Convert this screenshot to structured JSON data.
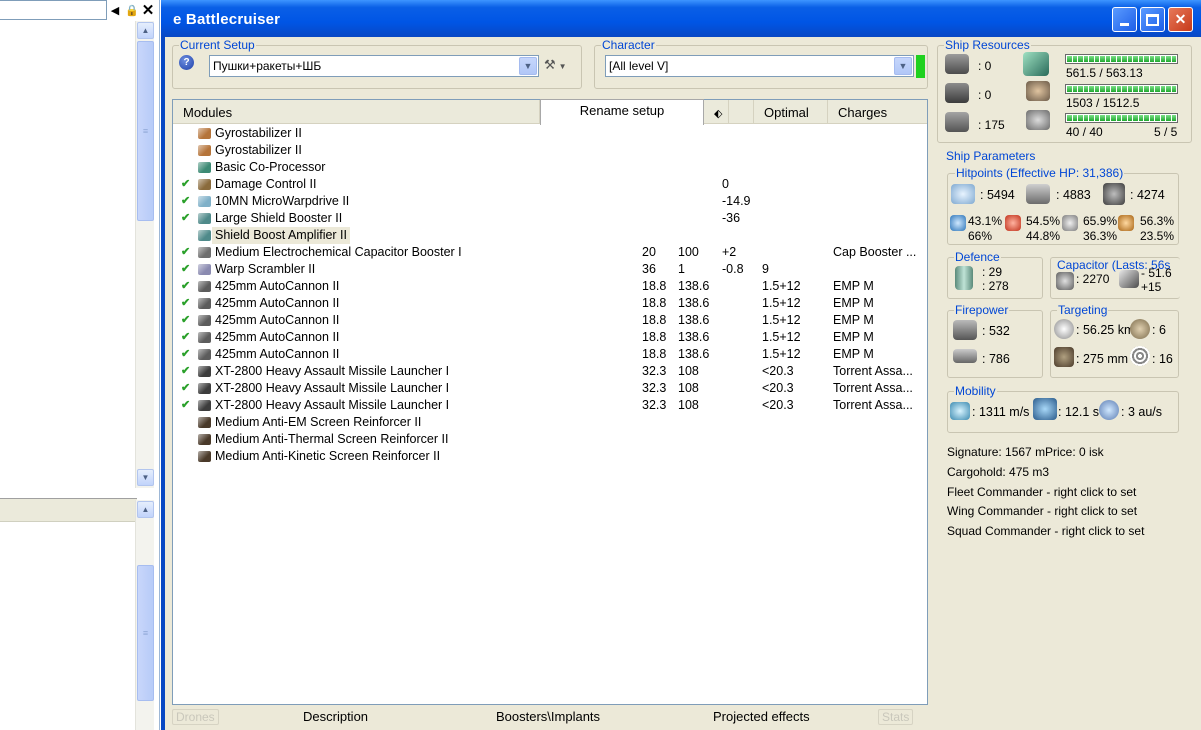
{
  "window": {
    "title": "e Battlecruiser"
  },
  "left_pane": {
    "topbar_icons": [
      "left-arrow-icon",
      "lock-icon",
      "close-icon"
    ]
  },
  "setup": {
    "group_label": "Current Setup",
    "value": "Пушки+ракеты+ШБ",
    "help_icon": "help-icon",
    "tool_icon": "wrench-icon"
  },
  "character": {
    "group_label": "Character",
    "value": "[All level V]",
    "indicator_color": "#1fd11f"
  },
  "modules": {
    "columns": [
      "Modules",
      "Rename setup",
      "",
      "Optimal",
      "Charges"
    ],
    "rows": [
      {
        "fit": false,
        "icon": "#b5743a",
        "name": "Gyrostabilizer II",
        "c1": "",
        "c2": "",
        "c3": "",
        "c4": "",
        "c5": ""
      },
      {
        "fit": false,
        "icon": "#b5743a",
        "name": "Gyrostabilizer II",
        "c1": "",
        "c2": "",
        "c3": "",
        "c4": "",
        "c5": ""
      },
      {
        "fit": false,
        "icon": "#3c8a74",
        "name": "Basic Co-Processor",
        "c1": "",
        "c2": "",
        "c3": "",
        "c4": "",
        "c5": ""
      },
      {
        "fit": true,
        "icon": "#8a6b3c",
        "name": "Damage Control II",
        "c1": "",
        "c2": "",
        "c3": "0",
        "c4": "",
        "c5": ""
      },
      {
        "fit": true,
        "icon": "#7fb0c8",
        "name": "10MN MicroWarpdrive II",
        "c1": "",
        "c2": "",
        "c3": "-14.9",
        "c4": "",
        "c5": ""
      },
      {
        "fit": true,
        "icon": "#4f8a8a",
        "name": "Large Shield Booster II",
        "c1": "",
        "c2": "",
        "c3": "-36",
        "c4": "",
        "c5": ""
      },
      {
        "fit": false,
        "icon": "#4f8a8a",
        "name": "Shield Boost Amplifier II",
        "c1": "",
        "c2": "",
        "c3": "",
        "c4": "",
        "c5": "",
        "selected": true
      },
      {
        "fit": true,
        "icon": "#6e6e6e",
        "name": "Medium Electrochemical Capacitor Booster I",
        "c1": "20",
        "c2": "100",
        "c3": "+2",
        "c4": "",
        "c5": "Cap Booster ..."
      },
      {
        "fit": true,
        "icon": "#8a8ab0",
        "name": "Warp Scrambler II",
        "c1": "36",
        "c2": "1",
        "c3": "-0.8",
        "c4": "9",
        "c5": ""
      },
      {
        "fit": true,
        "icon": "#5c5c5c",
        "name": "425mm AutoCannon II",
        "c1": "18.8",
        "c2": "138.6",
        "c3": "",
        "c4": "1.5+12",
        "c5": "EMP M"
      },
      {
        "fit": true,
        "icon": "#5c5c5c",
        "name": "425mm AutoCannon II",
        "c1": "18.8",
        "c2": "138.6",
        "c3": "",
        "c4": "1.5+12",
        "c5": "EMP M"
      },
      {
        "fit": true,
        "icon": "#5c5c5c",
        "name": "425mm AutoCannon II",
        "c1": "18.8",
        "c2": "138.6",
        "c3": "",
        "c4": "1.5+12",
        "c5": "EMP M"
      },
      {
        "fit": true,
        "icon": "#5c5c5c",
        "name": "425mm AutoCannon II",
        "c1": "18.8",
        "c2": "138.6",
        "c3": "",
        "c4": "1.5+12",
        "c5": "EMP M"
      },
      {
        "fit": true,
        "icon": "#5c5c5c",
        "name": "425mm AutoCannon II",
        "c1": "18.8",
        "c2": "138.6",
        "c3": "",
        "c4": "1.5+12",
        "c5": "EMP M"
      },
      {
        "fit": true,
        "icon": "#3d3d3d",
        "name": "XT-2800 Heavy Assault Missile Launcher I",
        "c1": "32.3",
        "c2": "108",
        "c3": "",
        "c4": "<20.3",
        "c5": "Torrent Assa..."
      },
      {
        "fit": true,
        "icon": "#3d3d3d",
        "name": "XT-2800 Heavy Assault Missile Launcher I",
        "c1": "32.3",
        "c2": "108",
        "c3": "",
        "c4": "<20.3",
        "c5": "Torrent Assa..."
      },
      {
        "fit": true,
        "icon": "#3d3d3d",
        "name": "XT-2800 Heavy Assault Missile Launcher I",
        "c1": "32.3",
        "c2": "108",
        "c3": "",
        "c4": "<20.3",
        "c5": "Torrent Assa..."
      },
      {
        "fit": false,
        "icon": "#4a3a2a",
        "name": "Medium Anti-EM Screen Reinforcer II",
        "c1": "",
        "c2": "",
        "c3": "",
        "c4": "",
        "c5": ""
      },
      {
        "fit": false,
        "icon": "#4a3a2a",
        "name": "Medium Anti-Thermal Screen Reinforcer II",
        "c1": "",
        "c2": "",
        "c3": "",
        "c4": "",
        "c5": ""
      },
      {
        "fit": false,
        "icon": "#4a3a2a",
        "name": "Medium Anti-Kinetic Screen Reinforcer II",
        "c1": "",
        "c2": "",
        "c3": "",
        "c4": "",
        "c5": ""
      }
    ]
  },
  "bottom_tabs": {
    "drones": "Drones",
    "description": "Description",
    "boosters": "Boosters\\Implants",
    "projected": "Projected effects",
    "stats": "Stats"
  },
  "resources": {
    "label": "Ship Resources",
    "hardpoints": [
      ": 0",
      ": 0",
      ": 175"
    ],
    "cpu": {
      "text": "561.5 / 563.13",
      "fraction": 0.997
    },
    "power": {
      "text": "1503 / 1512.5",
      "fraction": 0.994
    },
    "calibration": {
      "text": "40 / 40",
      "fraction": 1.0
    },
    "rig_slots": "5 / 5"
  },
  "params": {
    "label": "Ship Parameters",
    "hitpoints_label": "Hitpoints (Effective HP: 31,386)",
    "shield_hp": ": 5494",
    "armor_hp": ": 4883",
    "hull_hp": ": 4274",
    "resists": [
      {
        "top": "43.1%",
        "bottom": "66%"
      },
      {
        "top": "54.5%",
        "bottom": "44.8%"
      },
      {
        "top": "65.9%",
        "bottom": "36.3%"
      },
      {
        "top": "56.3%",
        "bottom": "23.5%"
      }
    ],
    "defence_label": "Defence",
    "defence_top": ": 29",
    "defence_bottom": ": 278",
    "capacitor_label": "Capacitor (Lasts: 56s",
    "capacitor_amount": ": 2270",
    "capacitor_use": "- 51.6",
    "capacitor_regen": "+15",
    "firepower_label": "Firepower",
    "firepower_top": ": 532",
    "firepower_bottom": ": 786",
    "targeting_label": "Targeting",
    "targeting_range": ": 56.25 km",
    "targeting_max": ": 6",
    "targeting_res": ": 275 mm",
    "targeting_sensor": ": 16",
    "mobility_label": "Mobility",
    "speed": ": 1311 m/s",
    "align": ": 12.1 s",
    "warp": ": 3 au/s",
    "signature": "Signature: 1567 m",
    "price": "Price: 0 isk",
    "cargohold": "Cargohold: 475 m3",
    "fleet_commander": "Fleet Commander - right click to set",
    "wing_commander": "Wing Commander - right click to set",
    "squad_commander": "Squad Commander - right click to set"
  }
}
